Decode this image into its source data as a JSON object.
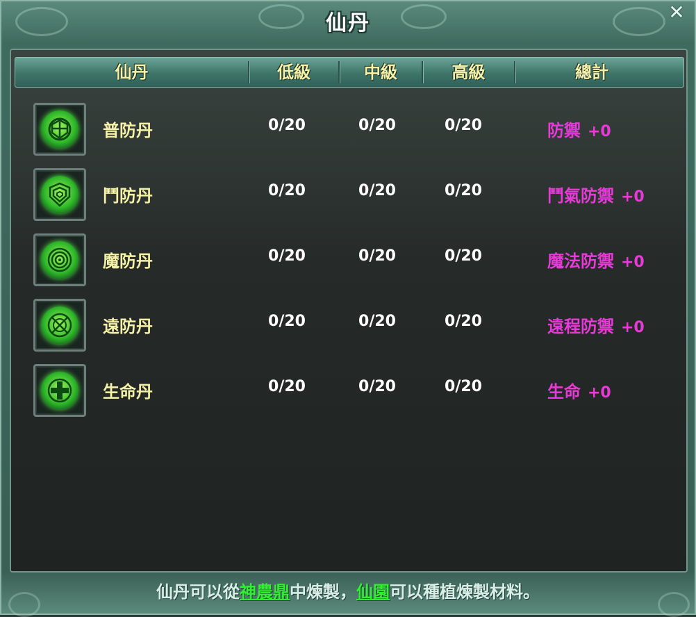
{
  "window": {
    "title": "仙丹",
    "close_icon": "close-icon"
  },
  "header": {
    "columns": [
      "仙丹",
      "低級",
      "中級",
      "高級",
      "總計"
    ]
  },
  "rows": [
    {
      "name": "普防丹",
      "icon": "shield-rune-icon",
      "low": "0/20",
      "mid": "0/20",
      "high": "0/20",
      "total_label": "防禦",
      "total_bonus": "+0"
    },
    {
      "name": "鬥防丹",
      "icon": "concentric-shield-icon",
      "low": "0/20",
      "mid": "0/20",
      "high": "0/20",
      "total_label": "鬥氣防禦",
      "total_bonus": "+0"
    },
    {
      "name": "魔防丹",
      "icon": "spiral-icon",
      "low": "0/20",
      "mid": "0/20",
      "high": "0/20",
      "total_label": "魔法防禦",
      "total_bonus": "+0"
    },
    {
      "name": "遠防丹",
      "icon": "crossed-circle-icon",
      "low": "0/20",
      "mid": "0/20",
      "high": "0/20",
      "total_label": "遠程防禦",
      "total_bonus": "+0"
    },
    {
      "name": "生命丹",
      "icon": "plus-icon",
      "low": "0/20",
      "mid": "0/20",
      "high": "0/20",
      "total_label": "生命",
      "total_bonus": "+0"
    }
  ],
  "footer": {
    "part1": "仙丹可以從",
    "link1": "神農鼎",
    "part2": "中煉製，",
    "link2": "仙園",
    "part3": "可以種植煉製材料。"
  },
  "colors": {
    "label": "#f5f1a6",
    "value": "#ffffff",
    "total": "#e83ad8",
    "link": "#33ee33"
  }
}
